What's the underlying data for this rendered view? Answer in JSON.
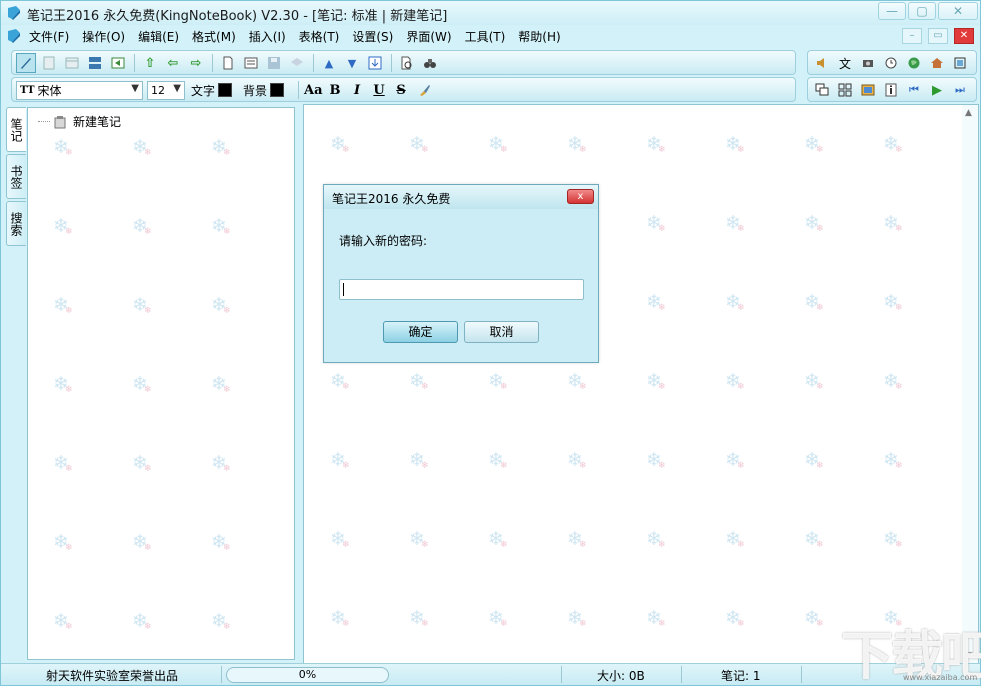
{
  "window": {
    "title": "笔记王2016 永久免费(KingNoteBook) V2.30 - [笔记: 标准 | 新建笔记]",
    "minimize_glyph": "—",
    "restore_glyph": "▢",
    "close_glyph": "✕"
  },
  "menu": {
    "items": [
      "文件(F)",
      "操作(O)",
      "编辑(E)",
      "格式(M)",
      "插入(I)",
      "表格(T)",
      "设置(S)",
      "界面(W)",
      "工具(T)",
      "帮助(H)"
    ],
    "mdi_min": "–",
    "mdi_restore": "▭",
    "mdi_close": "✕"
  },
  "format_bar": {
    "font_name": "宋体",
    "font_prefix": "TT",
    "font_size": "12",
    "text_color_label": "文字",
    "background_label": "背景",
    "text_color": "#000000",
    "background_color": "#000000",
    "style_buttons": [
      "Aa",
      "B",
      "I",
      "U",
      "S"
    ],
    "dropdown_glyph": "▼"
  },
  "side_tabs": [
    "笔记",
    "书签",
    "搜索"
  ],
  "tree": {
    "nodes": [
      {
        "label": "新建笔记"
      }
    ]
  },
  "dialog": {
    "title": "笔记王2016 永久免费",
    "prompt": "请输入新的密码:",
    "password_value": "",
    "ok_label": "确定",
    "cancel_label": "取消",
    "close_glyph": "x"
  },
  "statusbar": {
    "credit": "射天软件实验室荣誉出品",
    "progress": "0%",
    "progress_value": 0,
    "size": "大小: 0B",
    "notes_count": "笔记: 1"
  },
  "watermark": {
    "text": "下载吧",
    "sub": "www.xiazaiba.com"
  },
  "colors": {
    "accent": "#cdeef6",
    "close_red": "#d53333",
    "ok_blue": "#8cd0e3"
  }
}
